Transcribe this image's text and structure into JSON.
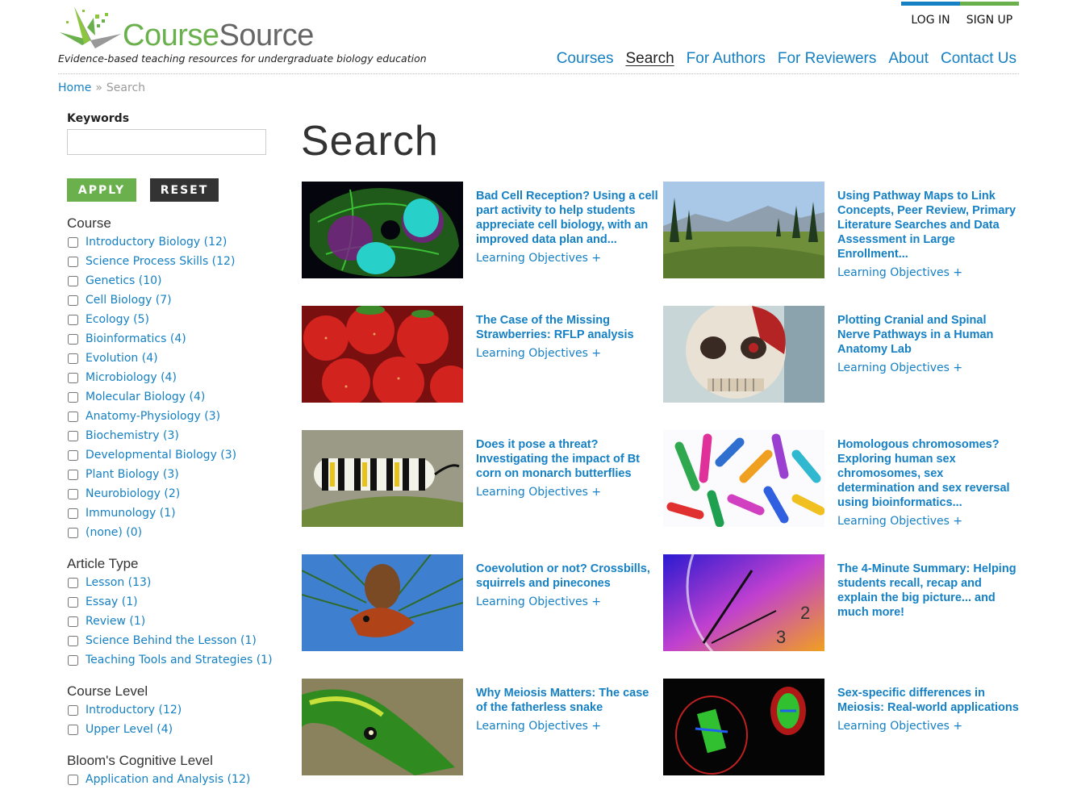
{
  "site": {
    "name_part1": "Course",
    "name_part2": "Source",
    "tagline": "Evidence-based teaching resources for undergraduate biology education",
    "brand_colors": {
      "blue": "#1580c3",
      "green": "#6ab04c"
    }
  },
  "auth": {
    "login": "LOG IN",
    "signup": "SIGN UP"
  },
  "nav": [
    {
      "label": "Courses",
      "active": false
    },
    {
      "label": "Search",
      "active": true
    },
    {
      "label": "For Authors",
      "active": false
    },
    {
      "label": "For Reviewers",
      "active": false
    },
    {
      "label": "About",
      "active": false
    },
    {
      "label": "Contact Us",
      "active": false
    }
  ],
  "breadcrumb": {
    "home": "Home",
    "separator": "»",
    "current": "Search"
  },
  "page_title": "Search",
  "filters": {
    "keywords_label": "Keywords",
    "keywords_value": "",
    "apply_label": "APPLY",
    "reset_label": "RESET",
    "facets": [
      {
        "title": "Course",
        "items": [
          "Introductory Biology (12)",
          "Science Process Skills (12)",
          "Genetics (10)",
          "Cell Biology (7)",
          "Ecology (5)",
          "Bioinformatics (4)",
          "Evolution (4)",
          "Microbiology (4)",
          "Molecular Biology (4)",
          "Anatomy-Physiology (3)",
          "Biochemistry (3)",
          "Developmental Biology (3)",
          "Plant Biology (3)",
          "Neurobiology (2)",
          "Immunology (1)",
          "(none) (0)"
        ]
      },
      {
        "title": "Article Type",
        "items": [
          "Lesson (13)",
          "Essay (1)",
          "Review (1)",
          "Science Behind the Lesson (1)",
          "Teaching Tools and Strategies (1)"
        ]
      },
      {
        "title": "Course Level",
        "items": [
          "Introductory (12)",
          "Upper Level (4)"
        ]
      },
      {
        "title": "Bloom's Cognitive Level",
        "items": [
          "Application and Analysis (12)"
        ]
      }
    ]
  },
  "results": [
    {
      "title": "Bad Cell Reception? Using a cell part activity to help students appreciate cell biology, with an improved data plan and...",
      "objectives_link": "Learning Objectives +",
      "image": "fluorescent-cells"
    },
    {
      "title": "Using Pathway Maps to Link Concepts, Peer Review, Primary Literature Searches and Data Assessment in Large Enrollment...",
      "objectives_link": "Learning Objectives +",
      "image": "mountain-meadow"
    },
    {
      "title": "The Case of the Missing Strawberries: RFLP analysis",
      "objectives_link": "Learning Objectives +",
      "image": "strawberries"
    },
    {
      "title": "Plotting Cranial and Spinal Nerve Pathways in a Human Anatomy Lab",
      "objectives_link": "Learning Objectives +",
      "image": "skull-model"
    },
    {
      "title": "Does it pose a threat? Investigating the impact of Bt corn on monarch butterflies",
      "objectives_link": "Learning Objectives +",
      "image": "caterpillar"
    },
    {
      "title": "Homologous chromosomes? Exploring human sex chromosomes, sex determination and sex reversal using bioinformatics...",
      "objectives_link": "Learning Objectives +",
      "image": "chromosomes"
    },
    {
      "title": "Coevolution or not? Crossbills, squirrels and pinecones",
      "objectives_link": "Learning Objectives +",
      "image": "crossbill-pinecone"
    },
    {
      "title": "The 4-Minute Summary: Helping students recall, recap and explain the big picture... and much more!",
      "objectives_link": "",
      "image": "clock"
    },
    {
      "title": "Why Meiosis Matters: The case of the fatherless snake",
      "objectives_link": "Learning Objectives +",
      "image": "green-snake"
    },
    {
      "title": "Sex-specific differences in Meiosis: Real-world applications",
      "objectives_link": "Learning Objectives +",
      "image": "meiosis-cells"
    }
  ]
}
